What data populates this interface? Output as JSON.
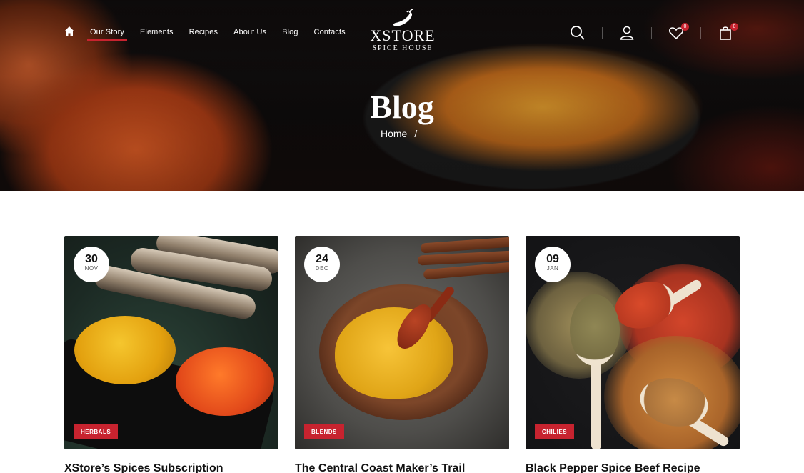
{
  "header": {
    "nav": [
      {
        "label": "Our Story",
        "active": true
      },
      {
        "label": "Elements",
        "active": false
      },
      {
        "label": "Recipes",
        "active": false
      },
      {
        "label": "About Us",
        "active": false
      },
      {
        "label": "Blog",
        "active": false
      },
      {
        "label": "Contacts",
        "active": false
      }
    ],
    "logo": {
      "name": "XSTORE",
      "tagline": "SPICE HOUSE"
    },
    "wishlist_count": "0",
    "cart_count": "0",
    "icons": [
      "home-icon",
      "search-icon",
      "user-icon",
      "heart-icon",
      "shopping-bag-icon"
    ]
  },
  "hero": {
    "title": "Blog",
    "breadcrumb": {
      "home": "Home",
      "separator": "/"
    }
  },
  "posts": [
    {
      "day": "30",
      "month": "NOV",
      "category": "HERBALS",
      "title": "XStore’s Spices Subscription"
    },
    {
      "day": "24",
      "month": "DEC",
      "category": "BLENDS",
      "title": "The Central Coast Maker’s Trail"
    },
    {
      "day": "09",
      "month": "JAN",
      "category": "CHILIES",
      "title": "Black Pepper Spice Beef Recipe"
    }
  ],
  "colors": {
    "accent": "#c7232f",
    "text": "#111111",
    "hero_text": "#ffffff"
  }
}
